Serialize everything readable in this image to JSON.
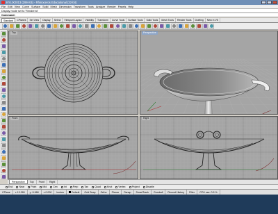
{
  "window": {
    "title": "KYLIX2013 (299 KB) - Rhinoceros Educational (32-bit)"
  },
  "menu": [
    "File",
    "Edit",
    "View",
    "Curve",
    "Surface",
    "Solid",
    "Mesh",
    "Dimension",
    "Transform",
    "Tools",
    "Analyze",
    "Render",
    "Panels",
    "Help"
  ],
  "command": {
    "history": "Display mode set to 'Rendered'",
    "prompt": "Command:"
  },
  "toolbar_tabs": [
    "Standard",
    "CPlanes",
    "Set View",
    "Display",
    "Select",
    "Viewport Layout",
    "Visibility",
    "Transform",
    "Curve Tools",
    "Surface Tools",
    "Solid Tools",
    "Mesh Tools",
    "Render Tools",
    "Drafting",
    "New in V5"
  ],
  "toolbar_tabs_active": 0,
  "toolbar_icons": [
    "new-file-icon",
    "open-icon",
    "save-icon",
    "print-icon",
    "import-icon",
    "cut-icon",
    "copy-icon",
    "paste-icon",
    "undo-icon",
    "redo-icon",
    "pan-icon",
    "rotate-icon",
    "zoom-icon",
    "zoom-window-icon",
    "zoom-extents-icon",
    "zoom-selected-icon",
    "undo-view-icon",
    "viewport-icon",
    "layers-icon",
    "properties-icon",
    "select-icon",
    "wireframe-icon",
    "shaded-icon",
    "rendered-icon",
    "light-icon",
    "material-icon",
    "hide-icon",
    "show-icon",
    "lock-icon",
    "unlock-icon",
    "grid-icon",
    "snap-icon",
    "options-icon",
    "help-icon"
  ],
  "viewports": {
    "top": {
      "label": "Top"
    },
    "perspective": {
      "label": "Perspective"
    },
    "front": {
      "label": "Front"
    },
    "right": {
      "label": "Right"
    }
  },
  "bottom_tabs": [
    "Perspective",
    "Top",
    "Front",
    "Right"
  ],
  "osnaps": [
    "End",
    "Near",
    "Point",
    "Mid",
    "Cen",
    "Int",
    "Perp",
    "Tan",
    "Quad",
    "Knot",
    "Vertex",
    "Project",
    "Disable"
  ],
  "status": {
    "cplane": "CPlane",
    "x": "x 13.265",
    "y": "y -5.968",
    "z": "z 0.000",
    "units": "Inches",
    "layer": "Default",
    "grid_snap": "Grid Snap",
    "ortho": "Ortho",
    "planar": "Planar",
    "osnap": "Osnap",
    "smarttrack": "SmartTrack",
    "gumball": "Gumball",
    "record_history": "Record History",
    "filter": "Filter",
    "cpu": "CPU use: 0.5 %"
  },
  "colors": {
    "viewport_bg": "#a5a5a5",
    "grid_minor": "#b4b4b4",
    "grid_major": "#8a8a8a",
    "x_axis": "#b03030",
    "y_axis": "#2e7d32",
    "title_bar": "#6f8fb7"
  }
}
